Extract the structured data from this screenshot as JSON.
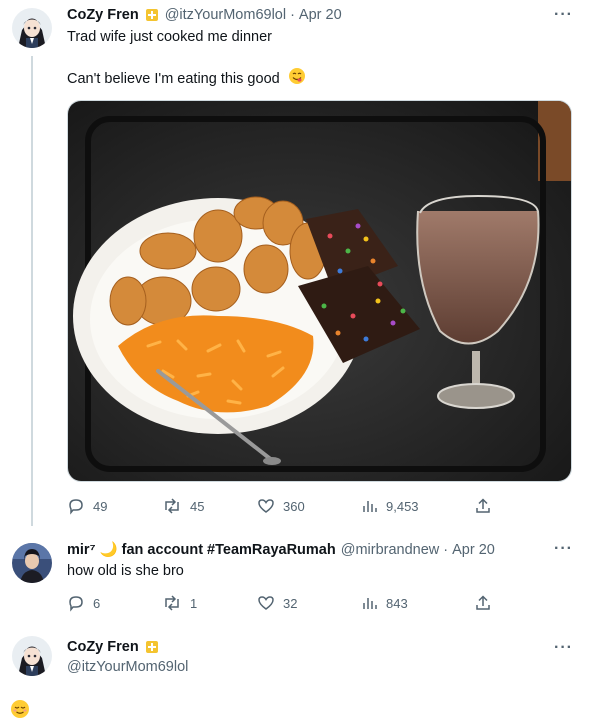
{
  "tweet1": {
    "name": "CoZy Fren",
    "handle": "@itzYourMom69lol",
    "sep": "·",
    "time": "Apr 20",
    "line1": "Trad wife just cooked me dinner",
    "line2": "Can't believe I'm eating this good",
    "line2_emoji_icon": "face-savoring-food-icon",
    "more": "···",
    "stats": {
      "replies": "49",
      "retweets": "45",
      "likes": "360",
      "views": "9,453"
    }
  },
  "reply": {
    "name": "mir⁷ 🌙 fan account #TeamRayaRumah",
    "handle": "@mirbrandnew",
    "sep": "·",
    "time": "Apr 20",
    "text": "how old is she bro",
    "more": "···",
    "stats": {
      "replies": "6",
      "retweets": "1",
      "likes": "32",
      "views": "843"
    }
  },
  "tweet3": {
    "name": "CoZy Fren",
    "handle": "@itzYourMom69lol",
    "more": "···",
    "body_emoji_icon": "relieved-face-icon"
  },
  "colors": {
    "muted": "#536471",
    "line": "#cfd9de",
    "text": "#0f1419"
  }
}
